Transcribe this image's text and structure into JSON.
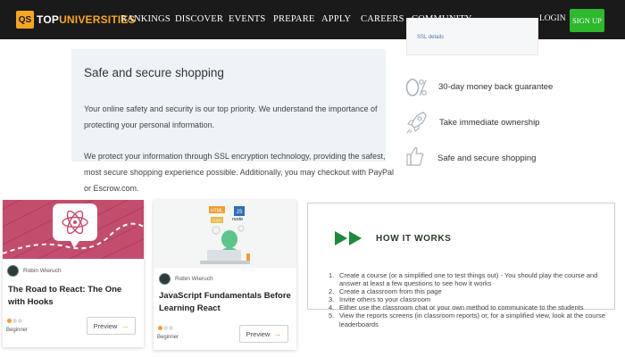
{
  "nav": {
    "logo_mark": "QS",
    "logo_top": "TOP",
    "logo_rest": "UNIVERSITIES",
    "items": [
      "RANKINGS",
      "DISCOVER",
      "EVENTS",
      "PREPARE",
      "APPLY",
      "CAREERS",
      "COMMUNITY"
    ],
    "login": "LOGIN",
    "signup": "SIGN UP"
  },
  "safe": {
    "title": "Safe and secure shopping",
    "p1": "Your online safety and security is our top priority. We understand the importance of protecting your personal information.",
    "p2": "We protect your information through SSL encryption technology, providing the safest, most secure shopping experience possible. Additionally, you may checkout with PayPal or Escrow.com."
  },
  "top_card": {
    "link": "SSL details"
  },
  "benefits": [
    {
      "icon": "percent-zero-icon",
      "text": "30-day money back guarantee"
    },
    {
      "icon": "rocket-icon",
      "text": "Take immediate ownership"
    },
    {
      "icon": "thumbs-up-icon",
      "text": "Safe and secure shopping"
    }
  ],
  "courses": [
    {
      "author": "Robin Wieruch",
      "title": "The Road to React: The One with Hooks",
      "level": "Beginner",
      "level_value": 1,
      "level_max": 3,
      "button": "Preview",
      "image": "react-logo-illustration"
    },
    {
      "author": "Robin Wieruch",
      "title": "JavaScript Fundamentals Before Learning React",
      "level": "Beginner",
      "level_value": 1,
      "level_max": 3,
      "button": "Preview",
      "image": "developer-laptop-illustration",
      "image_badges": [
        "HTML",
        "JS",
        "node",
        "CSS"
      ]
    }
  ],
  "how": {
    "title": "HOW IT WORKS",
    "steps": [
      "Create a course (or a simplified one to test things out) - You should play the course and answer at least a few questions to see how it works",
      "Create a classroom from this page",
      "Invite others to your classroom",
      "Either use the classroom chat or your own method to communicate to the students",
      "View the reports screens (in classroom reports) or, for a simplified view, look at the course leaderboards"
    ]
  },
  "colors": {
    "nav_bg": "#1a1a1a",
    "brand": "#f5a623",
    "signup": "#2eb82e",
    "accent_orange": "#f39c35",
    "how_green": "#1e8a3c",
    "panel_bg": "#eef3f7"
  }
}
